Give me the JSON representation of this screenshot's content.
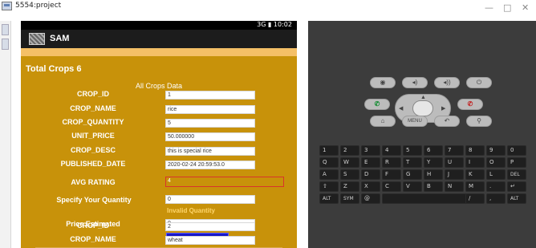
{
  "window": {
    "title": "5554:project",
    "minimize": "—",
    "restore": "□",
    "close": "✕"
  },
  "device": {
    "status_text": "3G ▮ 10:02",
    "app_title": "SAM"
  },
  "screen": {
    "total_label": "Total Crops 6",
    "heading": "All Crops Data",
    "fields": [
      {
        "label": "CROP_ID",
        "value": "1"
      },
      {
        "label": "CROP_NAME",
        "value": "rice"
      },
      {
        "label": "CROP_QUANTITY",
        "value": "5"
      },
      {
        "label": "UNIT_PRICE",
        "value": "50.000000"
      },
      {
        "label": "CROP_DESC",
        "value": "this is special rice"
      },
      {
        "label": "PUBLISHED_DATE",
        "value": "2020-02-24 20:59:53.0"
      }
    ],
    "avg_rating_label": "AVG RATING",
    "avg_rating_value": "4",
    "quantity_label": "Specify Your Quantity",
    "quantity_value": "0",
    "invalid_msg": "Invalid Quantity",
    "price_label": "Price Estimated",
    "price_value": "0",
    "order_button": "Place Order",
    "next_fields": [
      {
        "label": "CROP_ID",
        "value": "2"
      },
      {
        "label": "CROP_NAME",
        "value": "wheat"
      }
    ]
  },
  "controls": {
    "home": "⌂",
    "menu": "MENU",
    "back": "↶",
    "search": "⚲",
    "camera": "◉",
    "vol_down": "◂)",
    "vol_up": "◂))",
    "power": "⏻",
    "call": "✆",
    "end_call": "✆"
  },
  "keyboard": {
    "row1": [
      "1",
      "2",
      "3",
      "4",
      "5",
      "6",
      "7",
      "8",
      "9",
      "0"
    ],
    "row2": [
      "Q",
      "W",
      "E",
      "R",
      "T",
      "Y",
      "U",
      "I",
      "O",
      "P"
    ],
    "row3": [
      "A",
      "S",
      "D",
      "F",
      "G",
      "H",
      "J",
      "K",
      "L",
      "DEL"
    ],
    "row4": [
      "⇧",
      "Z",
      "X",
      "C",
      "V",
      "B",
      "N",
      "M",
      ".",
      "↵"
    ],
    "row5": [
      "ALT",
      "SYM",
      "@",
      "",
      "/",
      ",",
      "ALT"
    ]
  },
  "colors": {
    "screen_bg": "#c8920a",
    "band": "#f5c067",
    "button": "#1717c8",
    "warning": "#ffd66b",
    "panel": "#3c3c3c"
  }
}
